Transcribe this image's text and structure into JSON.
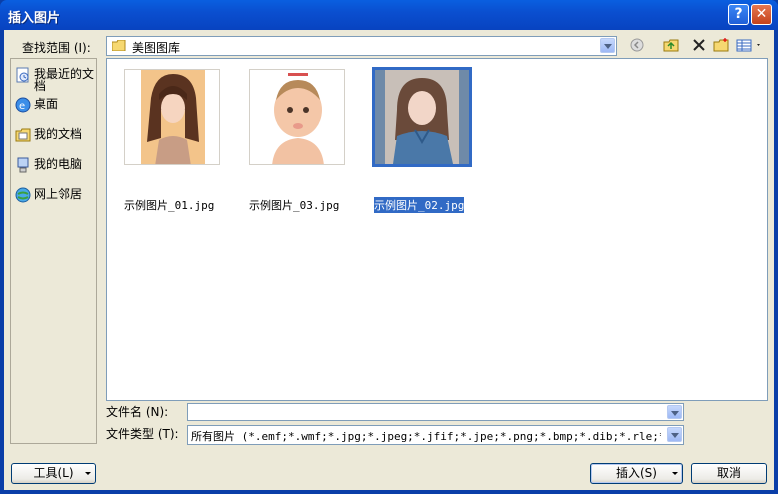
{
  "title": "插入图片",
  "titlebar_buttons": {
    "help": "?",
    "close": "✕"
  },
  "lookin": {
    "label": "查找范围 (I):",
    "value": "美图图库"
  },
  "places": [
    {
      "label1": "我最近的文",
      "label2": "档",
      "icon": "recent-docs-icon"
    },
    {
      "label1": "桌面",
      "icon": "desktop-icon"
    },
    {
      "label1": "我的文档",
      "icon": "my-documents-icon"
    },
    {
      "label1": "我的电脑",
      "icon": "my-computer-icon"
    },
    {
      "label1": "网上邻居",
      "icon": "network-places-icon"
    }
  ],
  "files": [
    {
      "name": "示例图片_01.jpg",
      "selected": false
    },
    {
      "name": "示例图片_03.jpg",
      "selected": false
    },
    {
      "name": "示例图片_02.jpg",
      "selected": true
    }
  ],
  "filename": {
    "label": "文件名 (N):",
    "value": ""
  },
  "filetype": {
    "label": "文件类型 (T):",
    "value": "所有图片 (*.emf;*.wmf;*.jpg;*.jpeg;*.jfif;*.jpe;*.png;*.bmp;*.dib;*.rle;*.gif;*."
  },
  "buttons": {
    "tools": "工具(L)",
    "insert": "插入(S)",
    "cancel": "取消"
  },
  "colors": {
    "titlebar": "#0a4fd0",
    "selection": "#316ac5",
    "dialog_bg": "#ece9d8"
  }
}
